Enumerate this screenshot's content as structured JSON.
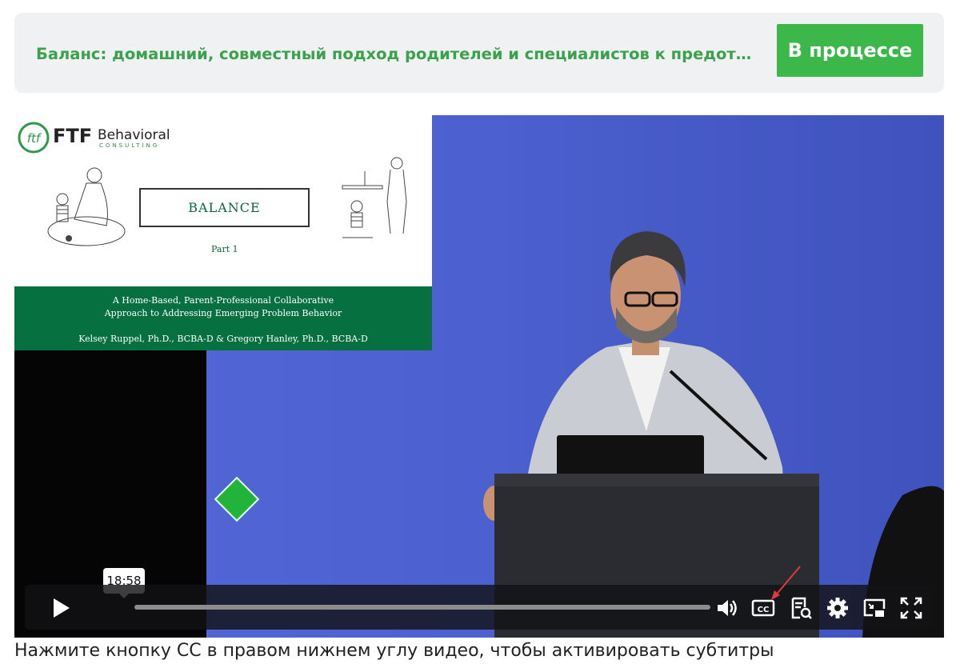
{
  "header": {
    "course_title": "Баланс: домашний, совместный подход родителей и специалистов к предотвращению проблемного поведения",
    "status_label": "В процессе"
  },
  "slide": {
    "brand_name": "FTF",
    "brand_name2": "Behavioral",
    "brand_sub": "CONSULTING",
    "balance_label": "BALANCE",
    "part_label": "Part 1",
    "subtitle_line1": "A Home-Based, Parent-Professional Collaborative",
    "subtitle_line2": "Approach to Addressing Emerging Problem Behavior",
    "authors": "Kelsey Ruppel, Ph.D., BCBA-D & Gregory Hanley, Ph.D., BCBA-D"
  },
  "player": {
    "time_tooltip": "18:58",
    "progress_percent": 0,
    "icons": [
      "play-icon",
      "volume-icon",
      "closed-captions-icon",
      "transcript-icon",
      "settings-icon",
      "picture-in-picture-icon",
      "fullscreen-icon"
    ]
  },
  "footer": {
    "caption_hint": "Нажмите кнопку CC в правом нижнем углу видео, чтобы активировать субтитры"
  },
  "colors": {
    "accent_green": "#3cb74a",
    "title_green": "#3aa24a",
    "slide_green": "#067040",
    "wall_blue": "#4b5fcf"
  }
}
